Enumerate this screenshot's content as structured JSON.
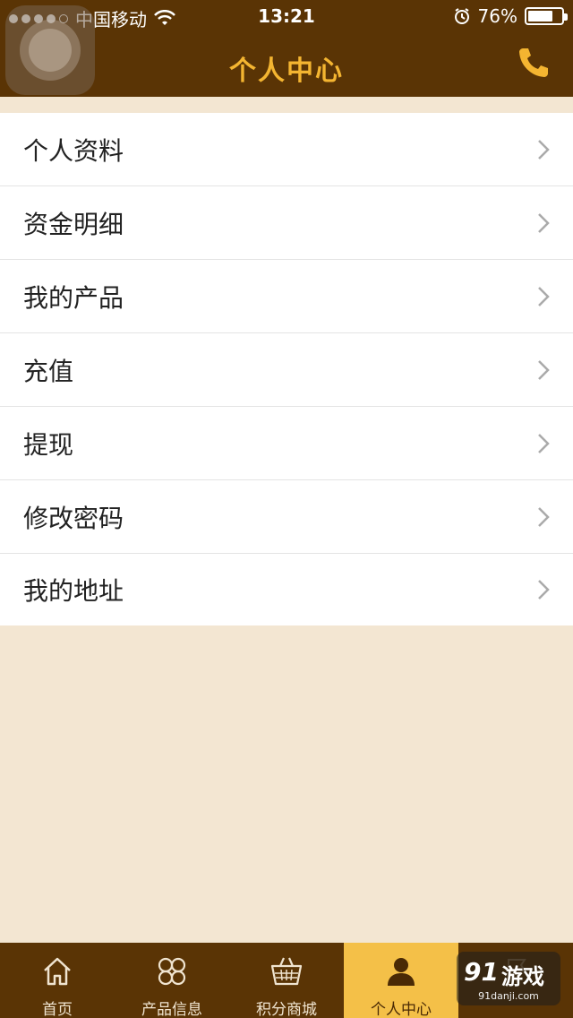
{
  "status_bar": {
    "carrier": "中国移动",
    "time": "13:21",
    "battery": "76%",
    "battery_level": 0.76,
    "signal_bars": 4,
    "signal_total": 5
  },
  "header": {
    "title": "个人中心"
  },
  "menu": {
    "items": [
      {
        "label": "个人资料"
      },
      {
        "label": "资金明细"
      },
      {
        "label": "我的产品"
      },
      {
        "label": "充值"
      },
      {
        "label": "提现"
      },
      {
        "label": "修改密码"
      },
      {
        "label": "我的地址"
      }
    ]
  },
  "tab_bar": {
    "tabs": [
      {
        "label": "首页",
        "icon": "home-icon"
      },
      {
        "label": "产品信息",
        "icon": "clover-icon"
      },
      {
        "label": "积分商城",
        "icon": "basket-icon"
      },
      {
        "label": "个人中心",
        "icon": "user-icon",
        "active": true
      }
    ]
  },
  "watermark": {
    "logo": "91",
    "name": "游戏",
    "site": "91danji.com"
  },
  "colors": {
    "brand_brown": "#5a3405",
    "accent_gold": "#f4b531",
    "active_tab": "#f4c048",
    "background": "#f3e6d2"
  }
}
